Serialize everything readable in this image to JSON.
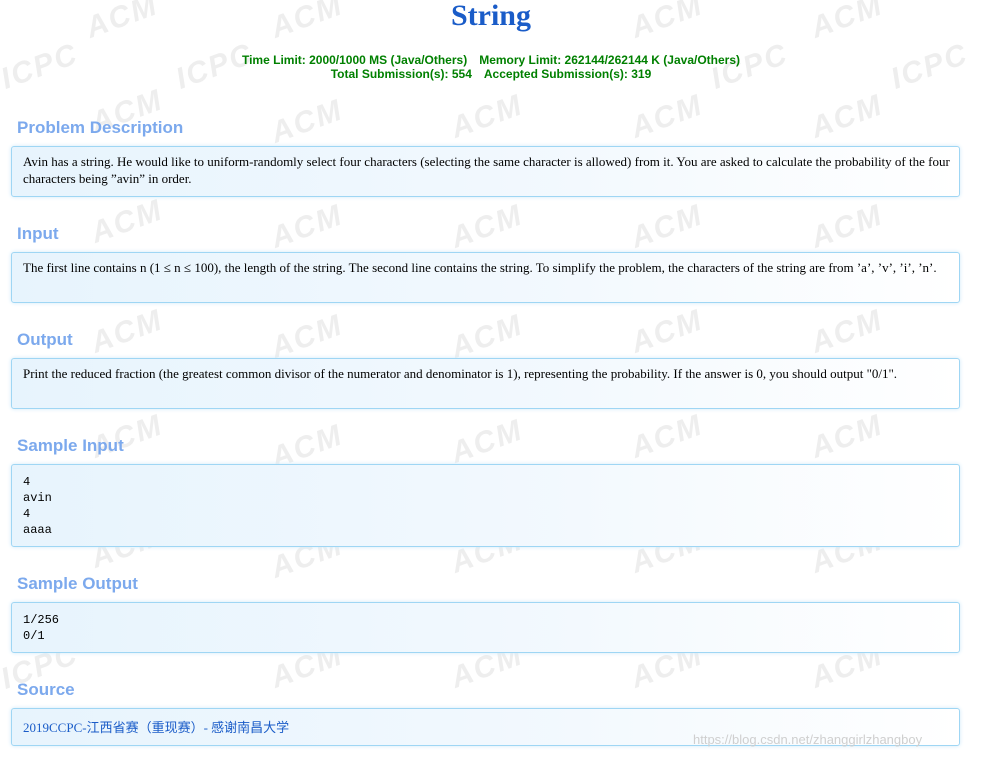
{
  "problem": {
    "title": "String",
    "time_limit": "Time Limit: 2000/1000 MS (Java/Others)",
    "memory_limit": "Memory Limit: 262144/262144 K (Java/Others)",
    "total_submissions": "Total Submission(s): 554",
    "accepted_submissions": "Accepted Submission(s): 319"
  },
  "sections": {
    "description": {
      "heading": "Problem Description",
      "text": "Avin has a string. He would like to uniform-randomly select four characters (selecting the same character is allowed) from it. You are asked to calculate the probability of the four characters being ”avin” in order."
    },
    "input": {
      "heading": "Input",
      "text": "The first line contains n (1 ≤ n ≤ 100), the length of the string. The second line contains the string. To simplify the problem, the characters of the string are from ’a’, ’v’, ’i’, ’n’."
    },
    "output": {
      "heading": "Output",
      "text": "Print the reduced fraction (the greatest common divisor of the numerator and denominator is 1), representing the probability. If the answer is 0, you should output \"0/1\"."
    },
    "sample_input": {
      "heading": "Sample Input",
      "text": "4\navin\n4\naaaa"
    },
    "sample_output": {
      "heading": "Sample Output",
      "text": "1/256\n0/1"
    },
    "source": {
      "heading": "Source",
      "link": "2019CCPC-江西省赛（重现赛）- 感谢南昌大学"
    }
  },
  "watermark": {
    "acm": "ACM",
    "icpc": "ICPC",
    "csdn_url": "https://blog.csdn.net/zhanggirlzhangboy"
  },
  "colors": {
    "title": "#1a5cc8",
    "limits": "#008000",
    "section_heading": "#7ca9ed",
    "panel_border": "#9fd6f4",
    "link": "#1a5cc8"
  }
}
